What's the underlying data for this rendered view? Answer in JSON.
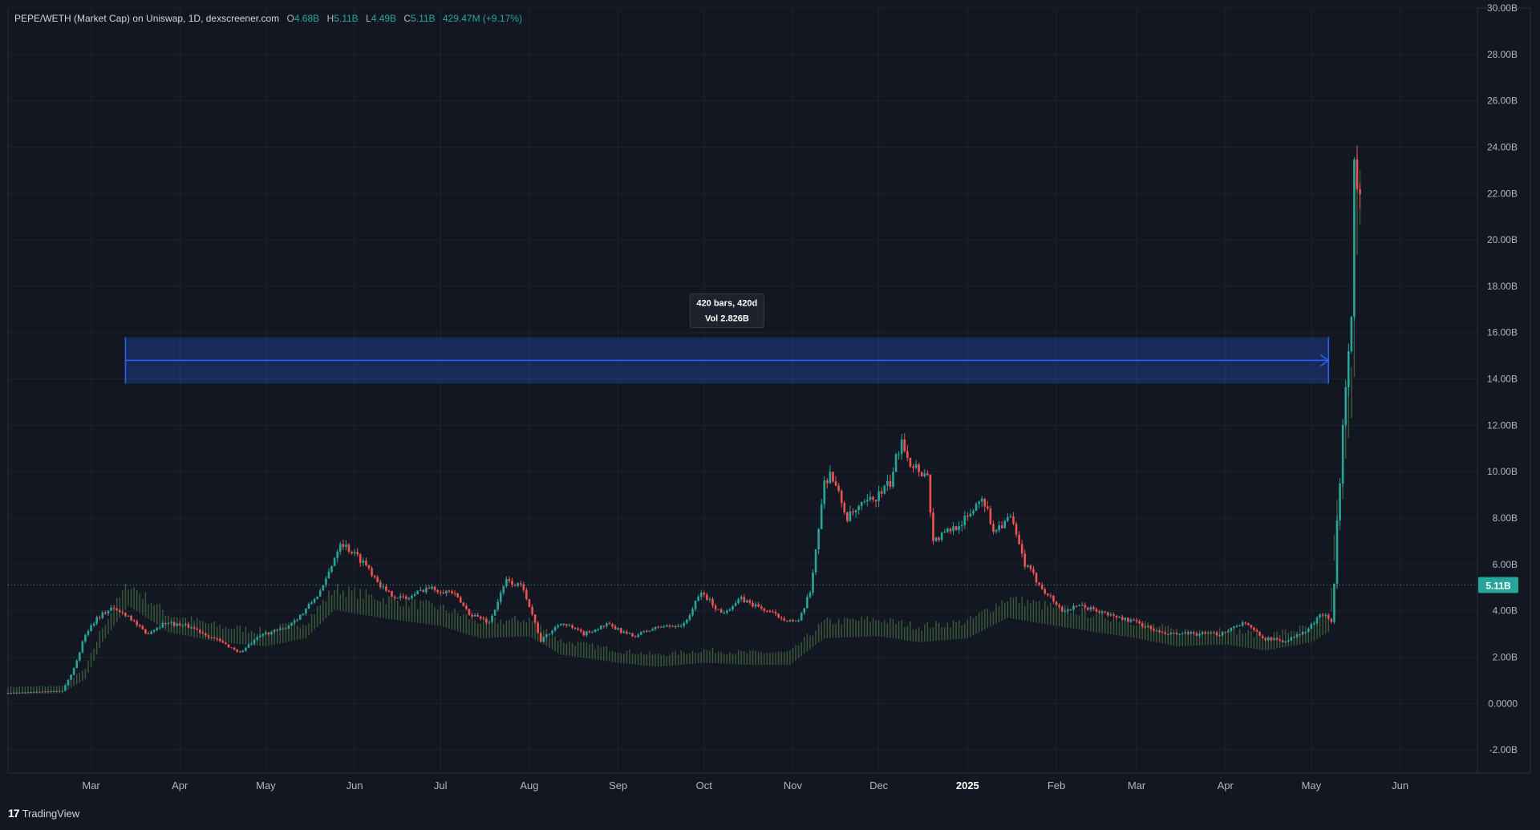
{
  "header": {
    "symbol": "PEPE/WETH (Market Cap) on Uniswap, 1D, dexscreener.com",
    "open_label": "O",
    "open": "4.68B",
    "high_label": "H",
    "high": "5.11B",
    "low_label": "L",
    "low": "4.49B",
    "close_label": "C",
    "close": "5.11B",
    "change": "429.47M (+9.17%)"
  },
  "footer": {
    "brand_logo": "17",
    "brand": "TradingView"
  },
  "colors": {
    "background": "#131722",
    "up": "#26a69a",
    "down": "#ef5350",
    "volume": "#3a5a3a",
    "measure": "#2962ff",
    "price_label": "#26a69a"
  },
  "chart_data": {
    "type": "candlestick",
    "interval": "1D",
    "y_axis": {
      "min": -3.0,
      "max": 30.0,
      "ticks": [
        30,
        28,
        26,
        24,
        22,
        20,
        18,
        16,
        14,
        12,
        10,
        8,
        6,
        4,
        2,
        0,
        -2
      ],
      "tick_labels": [
        "30.00B",
        "28.00B",
        "26.00B",
        "24.00B",
        "22.00B",
        "20.00B",
        "18.00B",
        "16.00B",
        "14.00B",
        "12.00B",
        "10.00B",
        "8.00B",
        "6.00B",
        "4.00B",
        "2.00B",
        "0.0000",
        "-2.00B"
      ]
    },
    "x_axis": {
      "start": "2024-02-01",
      "end": "2025-06-28",
      "ticks": [
        {
          "date": "2024-03-01",
          "label": "Mar"
        },
        {
          "date": "2024-04-01",
          "label": "Apr"
        },
        {
          "date": "2024-05-01",
          "label": "May"
        },
        {
          "date": "2024-06-01",
          "label": "Jun"
        },
        {
          "date": "2024-07-01",
          "label": "Jul"
        },
        {
          "date": "2024-08-01",
          "label": "Aug"
        },
        {
          "date": "2024-09-01",
          "label": "Sep"
        },
        {
          "date": "2024-10-01",
          "label": "Oct"
        },
        {
          "date": "2024-11-01",
          "label": "Nov"
        },
        {
          "date": "2024-12-01",
          "label": "Dec"
        },
        {
          "date": "2025-01-01",
          "label": "2025",
          "bold": true
        },
        {
          "date": "2025-02-01",
          "label": "Feb"
        },
        {
          "date": "2025-03-01",
          "label": "Mar"
        },
        {
          "date": "2025-04-01",
          "label": "Apr"
        },
        {
          "date": "2025-05-01",
          "label": "May"
        },
        {
          "date": "2025-06-01",
          "label": "Jun"
        }
      ]
    },
    "series": [
      {
        "kind": "market_cap",
        "dates": [
          "2024-02-01",
          "2024-02-20",
          "2024-02-24",
          "2024-02-28",
          "2024-03-03",
          "2024-03-08",
          "2024-03-14",
          "2024-03-20",
          "2024-03-27",
          "2024-04-05",
          "2024-04-13",
          "2024-04-22",
          "2024-04-30",
          "2024-05-07",
          "2024-05-14",
          "2024-05-21",
          "2024-05-27",
          "2024-06-05",
          "2024-06-12",
          "2024-06-19",
          "2024-06-26",
          "2024-07-05",
          "2024-07-11",
          "2024-07-18",
          "2024-07-24",
          "2024-07-30",
          "2024-08-05",
          "2024-08-12",
          "2024-08-20",
          "2024-08-28",
          "2024-09-06",
          "2024-09-15",
          "2024-09-24",
          "2024-09-30",
          "2024-10-07",
          "2024-10-14",
          "2024-10-21",
          "2024-10-28",
          "2024-11-03",
          "2024-11-07",
          "2024-11-12",
          "2024-11-14",
          "2024-11-20",
          "2024-11-25",
          "2024-12-01",
          "2024-12-05",
          "2024-12-09",
          "2024-12-12",
          "2024-12-18",
          "2024-12-20",
          "2024-12-26",
          "2025-01-01",
          "2025-01-06",
          "2025-01-10",
          "2025-01-16",
          "2025-01-21",
          "2025-01-27",
          "2025-02-03",
          "2025-02-10",
          "2025-02-20",
          "2025-03-01",
          "2025-03-10",
          "2025-03-20",
          "2025-03-30",
          "2025-04-07",
          "2025-04-15",
          "2025-04-22",
          "2025-04-29",
          "2025-05-05",
          "2025-05-07",
          "2025-05-08",
          "2025-05-09",
          "2025-05-10",
          "2025-05-11",
          "2025-05-12",
          "2025-05-13",
          "2025-05-14",
          "2025-05-15",
          "2025-05-16",
          "2025-05-17",
          "2025-05-18"
        ],
        "values": [
          0.45,
          0.55,
          1.5,
          3.0,
          3.7,
          4.1,
          3.8,
          3.0,
          3.5,
          3.3,
          2.8,
          2.2,
          3.0,
          3.2,
          3.9,
          5.0,
          7.0,
          6.0,
          4.8,
          4.5,
          5.0,
          4.8,
          3.9,
          3.5,
          5.3,
          5.0,
          2.7,
          3.5,
          3.0,
          3.4,
          2.9,
          3.3,
          3.4,
          4.8,
          3.9,
          4.5,
          4.1,
          3.7,
          3.5,
          4.8,
          9.5,
          10.0,
          8.0,
          8.5,
          9.0,
          9.5,
          11.5,
          10.4,
          9.8,
          7.0,
          7.5,
          8.0,
          9.0,
          7.5,
          8.0,
          6.0,
          5.0,
          4.0,
          4.2,
          3.8,
          3.5,
          3.0,
          3.0,
          3.0,
          3.5,
          2.8,
          2.7,
          3.1,
          3.9,
          3.7,
          3.6,
          5.1,
          8.0,
          9.5,
          12.0,
          13.5,
          15.0,
          16.5,
          23.0,
          22.0,
          22.5
        ]
      },
      {
        "kind": "volume",
        "dates": [
          "2024-02-01",
          "2024-02-20",
          "2024-02-28",
          "2024-03-05",
          "2024-03-14",
          "2024-03-28",
          "2024-04-15",
          "2024-05-01",
          "2024-05-15",
          "2024-05-25",
          "2024-06-10",
          "2024-07-01",
          "2024-07-15",
          "2024-08-01",
          "2024-08-12",
          "2024-09-01",
          "2024-09-15",
          "2024-10-01",
          "2024-10-15",
          "2024-10-31",
          "2024-11-12",
          "2024-12-01",
          "2024-12-15",
          "2025-01-01",
          "2025-01-15",
          "2025-02-01",
          "2025-02-15",
          "2025-03-01",
          "2025-03-15",
          "2025-04-01",
          "2025-04-15",
          "2025-05-01",
          "2025-05-07",
          "2025-05-08",
          "2025-05-09",
          "2025-05-10",
          "2025-05-11",
          "2025-05-12",
          "2025-05-13",
          "2025-05-14",
          "2025-05-15",
          "2025-05-16",
          "2025-05-17",
          "2025-05-18"
        ],
        "values": [
          0.45,
          0.5,
          1.2,
          3.0,
          4.8,
          3.5,
          3.0,
          2.8,
          3.2,
          4.6,
          4.2,
          3.8,
          3.2,
          3.3,
          2.4,
          2.0,
          1.8,
          2.0,
          1.9,
          1.9,
          3.2,
          3.3,
          3.0,
          3.2,
          4.2,
          3.8,
          3.5,
          3.2,
          2.8,
          2.9,
          2.6,
          3.0,
          3.5,
          4.5,
          7.0,
          8.0,
          8.5,
          10.0,
          12.0,
          13.0,
          14.0,
          16.0,
          22.0,
          23.5
        ]
      }
    ],
    "last_price": {
      "value": 5.11,
      "label": "5.11B"
    },
    "measure": {
      "start": "2024-03-13",
      "end": "2025-05-07",
      "top": 15.8,
      "bottom": 13.8,
      "arrow_level": 14.8,
      "label_line1": "420 bars, 420d",
      "label_line2": "Vol 2.826B"
    },
    "grid": true
  }
}
